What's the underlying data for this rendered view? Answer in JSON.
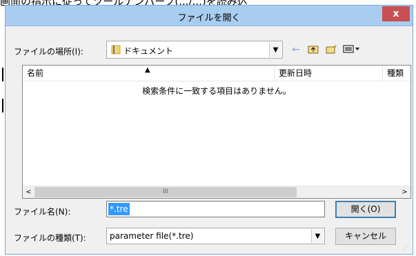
{
  "background_text": "画面の指示に従ってツールナンバーフ(.../...)を読み込",
  "dialog": {
    "title": "ファイルを開く",
    "close_label": "x"
  },
  "location": {
    "label": "ファイルの場所(I):",
    "value": "ドキュメント"
  },
  "toolbar_icons": [
    "back-arrow-icon",
    "up-folder-icon",
    "new-folder-icon",
    "view-menu-icon"
  ],
  "file_list": {
    "columns": [
      "名前",
      "更新日時",
      "種類"
    ],
    "sort_column": "名前",
    "empty_message": "検索条件に一致する項目はありません。",
    "scroll_left": "<",
    "scroll_right": ">",
    "scroll_grip": "III"
  },
  "filename": {
    "label": "ファイル名(N):",
    "value": "*.tre"
  },
  "filetype": {
    "label": "ファイルの種類(T):",
    "value": "parameter file(*.tre)"
  },
  "buttons": {
    "open": "開く(O)",
    "cancel": "キャンセル"
  },
  "colors": {
    "titlebar": "#a9cdf0",
    "close_button": "#c75050",
    "selection": "#3399ff",
    "dialog_bg": "#f0f0f0"
  }
}
